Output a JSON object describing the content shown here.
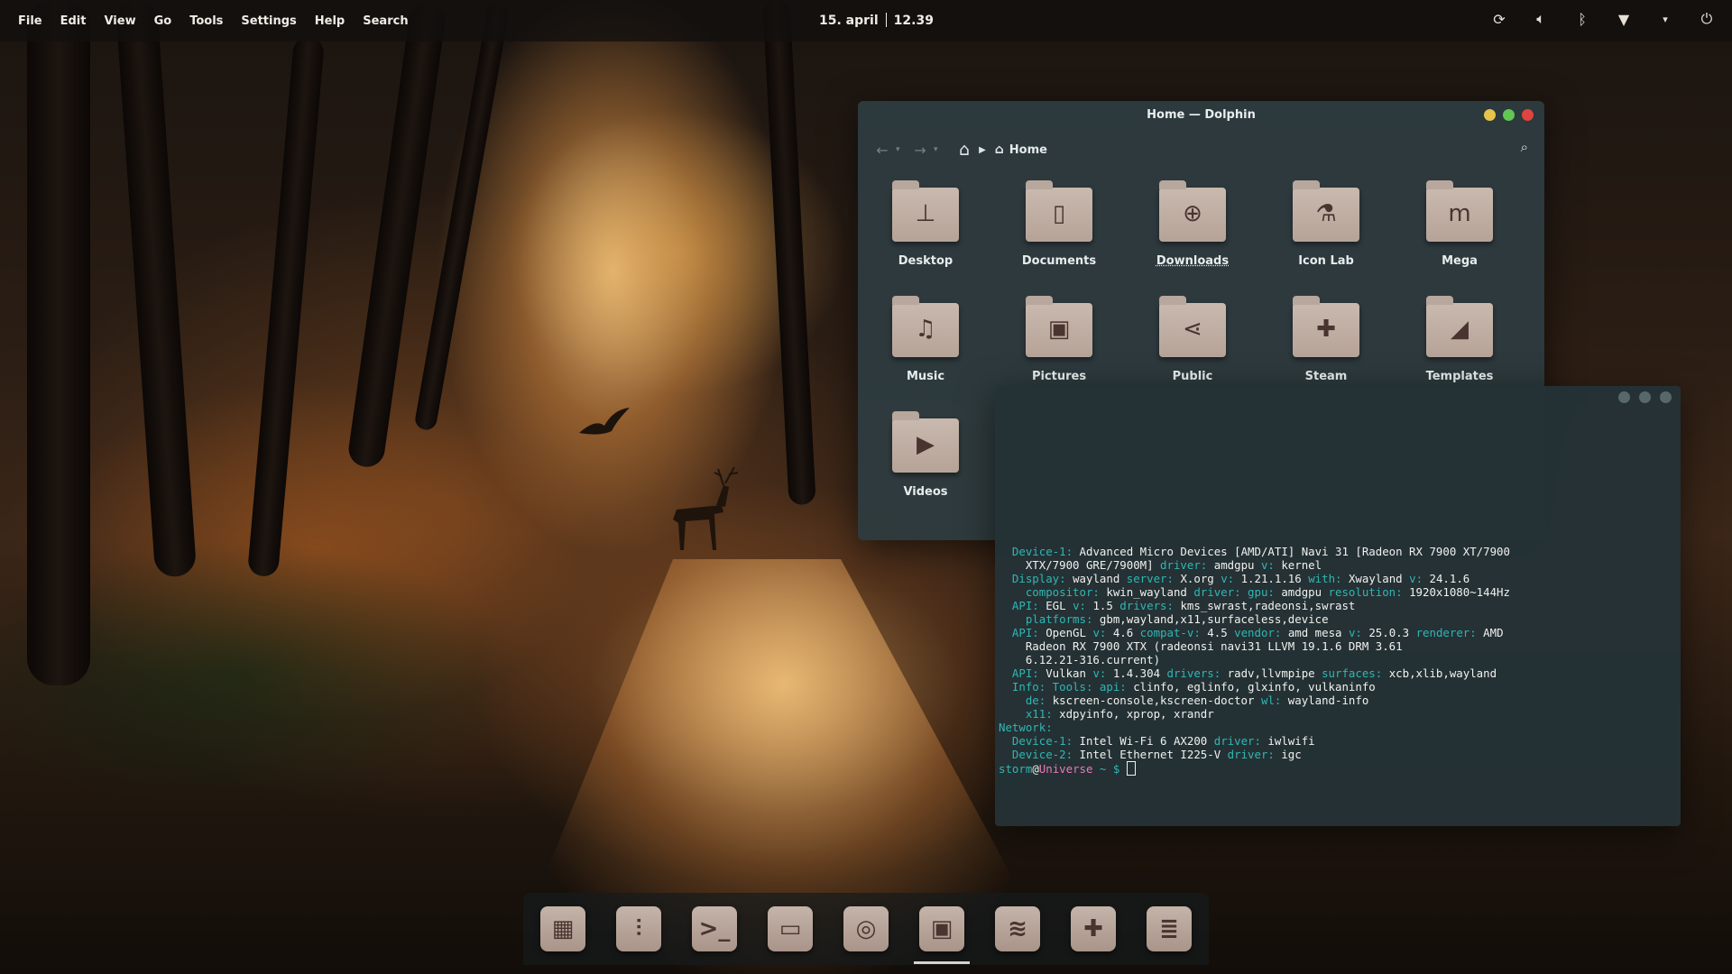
{
  "menu_bar": [
    "File",
    "Edit",
    "View",
    "Go",
    "Tools",
    "Settings",
    "Help",
    "Search"
  ],
  "clock": {
    "date": "15. april",
    "time": "12.39"
  },
  "tray_icons": [
    "sync-icon",
    "volume-icon",
    "bluetooth-icon",
    "wifi-icon",
    "chevron-down-icon",
    "power-icon"
  ],
  "dolphin": {
    "title": "Home — Dolphin",
    "breadcrumb": "Home",
    "window_controls": {
      "minimize": "#e6c34a",
      "maximize": "#62c554",
      "close": "#e0443e"
    },
    "items": [
      {
        "label": "Desktop",
        "icon": "desktop-folder-icon",
        "glyph": "⊥"
      },
      {
        "label": "Documents",
        "icon": "documents-folder-icon",
        "glyph": "▯"
      },
      {
        "label": "Downloads",
        "icon": "downloads-folder-icon",
        "glyph": "⊕"
      },
      {
        "label": "Icon Lab",
        "icon": "flask-folder-icon",
        "glyph": "⚗"
      },
      {
        "label": "Mega",
        "icon": "mega-folder-icon",
        "glyph": "m"
      },
      {
        "label": "Music",
        "icon": "music-folder-icon",
        "glyph": "♫"
      },
      {
        "label": "Pictures",
        "icon": "pictures-folder-icon",
        "glyph": "▣"
      },
      {
        "label": "Public",
        "icon": "share-folder-icon",
        "glyph": "⋖"
      },
      {
        "label": "Steam",
        "icon": "gamepad-folder-icon",
        "glyph": "✚"
      },
      {
        "label": "Templates",
        "icon": "templates-folder-icon",
        "glyph": "◢"
      },
      {
        "label": "Videos",
        "icon": "videos-folder-icon",
        "glyph": "▶"
      }
    ]
  },
  "terminal": {
    "lines": [
      [
        {
          "c": "k",
          "t": "  Device-1: "
        },
        {
          "c": "v",
          "t": "Advanced Micro Devices [AMD/ATI] Navi 31 [Radeon RX 7900 XT/7900"
        }
      ],
      [
        {
          "c": "v",
          "t": "    XTX/7900 GRE/7900M] "
        },
        {
          "c": "k",
          "t": "driver: "
        },
        {
          "c": "v",
          "t": "amdgpu "
        },
        {
          "c": "k",
          "t": "v: "
        },
        {
          "c": "v",
          "t": "kernel"
        }
      ],
      [
        {
          "c": "k",
          "t": "  Display: "
        },
        {
          "c": "v",
          "t": "wayland "
        },
        {
          "c": "k",
          "t": "server: "
        },
        {
          "c": "v",
          "t": "X.org "
        },
        {
          "c": "k",
          "t": "v: "
        },
        {
          "c": "v",
          "t": "1.21.1.16 "
        },
        {
          "c": "k",
          "t": "with: "
        },
        {
          "c": "v",
          "t": "Xwayland "
        },
        {
          "c": "k",
          "t": "v: "
        },
        {
          "c": "v",
          "t": "24.1.6"
        }
      ],
      [
        {
          "c": "k",
          "t": "    compositor: "
        },
        {
          "c": "v",
          "t": "kwin_wayland "
        },
        {
          "c": "k",
          "t": "driver: gpu: "
        },
        {
          "c": "v",
          "t": "amdgpu "
        },
        {
          "c": "k",
          "t": "resolution: "
        },
        {
          "c": "v",
          "t": "1920x1080~144Hz"
        }
      ],
      [
        {
          "c": "k",
          "t": "  API: "
        },
        {
          "c": "v",
          "t": "EGL "
        },
        {
          "c": "k",
          "t": "v: "
        },
        {
          "c": "v",
          "t": "1.5 "
        },
        {
          "c": "k",
          "t": "drivers: "
        },
        {
          "c": "v",
          "t": "kms_swrast,radeonsi,swrast"
        }
      ],
      [
        {
          "c": "k",
          "t": "    platforms: "
        },
        {
          "c": "v",
          "t": "gbm,wayland,x11,surfaceless,device"
        }
      ],
      [
        {
          "c": "k",
          "t": "  API: "
        },
        {
          "c": "v",
          "t": "OpenGL "
        },
        {
          "c": "k",
          "t": "v: "
        },
        {
          "c": "v",
          "t": "4.6 "
        },
        {
          "c": "k",
          "t": "compat-v: "
        },
        {
          "c": "v",
          "t": "4.5 "
        },
        {
          "c": "k",
          "t": "vendor: "
        },
        {
          "c": "v",
          "t": "amd mesa "
        },
        {
          "c": "k",
          "t": "v: "
        },
        {
          "c": "v",
          "t": "25.0.3 "
        },
        {
          "c": "k",
          "t": "renderer: "
        },
        {
          "c": "v",
          "t": "AMD"
        }
      ],
      [
        {
          "c": "v",
          "t": "    Radeon RX 7900 XTX (radeonsi navi31 LLVM 19.1.6 DRM 3.61"
        }
      ],
      [
        {
          "c": "v",
          "t": "    6.12.21-316.current)"
        }
      ],
      [
        {
          "c": "k",
          "t": "  API: "
        },
        {
          "c": "v",
          "t": "Vulkan "
        },
        {
          "c": "k",
          "t": "v: "
        },
        {
          "c": "v",
          "t": "1.4.304 "
        },
        {
          "c": "k",
          "t": "drivers: "
        },
        {
          "c": "v",
          "t": "radv,llvmpipe "
        },
        {
          "c": "k",
          "t": "surfaces: "
        },
        {
          "c": "v",
          "t": "xcb,xlib,wayland"
        }
      ],
      [
        {
          "c": "k",
          "t": "  Info: Tools: api: "
        },
        {
          "c": "v",
          "t": "clinfo, eglinfo, glxinfo, vulkaninfo"
        }
      ],
      [
        {
          "c": "k",
          "t": "    de: "
        },
        {
          "c": "v",
          "t": "kscreen-console,kscreen-doctor "
        },
        {
          "c": "k",
          "t": "wl: "
        },
        {
          "c": "v",
          "t": "wayland-info"
        }
      ],
      [
        {
          "c": "k",
          "t": "    x11: "
        },
        {
          "c": "v",
          "t": "xdpyinfo, xprop, xrandr"
        }
      ],
      [
        {
          "c": "sec",
          "t": "Network:"
        }
      ],
      [
        {
          "c": "k",
          "t": "  Device-1: "
        },
        {
          "c": "v",
          "t": "Intel Wi-Fi 6 AX200 "
        },
        {
          "c": "k",
          "t": "driver: "
        },
        {
          "c": "v",
          "t": "iwlwifi"
        }
      ],
      [
        {
          "c": "k",
          "t": "  Device-2: "
        },
        {
          "c": "v",
          "t": "Intel Ethernet I225-V "
        },
        {
          "c": "k",
          "t": "driver: "
        },
        {
          "c": "v",
          "t": "igc"
        }
      ]
    ],
    "prompt": {
      "user": "storm",
      "at": "@",
      "host": "Universe",
      "rest": " ~ $ "
    }
  },
  "dock": [
    {
      "name": "app-grid-icon",
      "glyph": "▦"
    },
    {
      "name": "mixer-icon",
      "glyph": "⫶"
    },
    {
      "name": "terminal-icon",
      "glyph": ">_"
    },
    {
      "name": "briefcase-icon",
      "glyph": "▭"
    },
    {
      "name": "browser-icon",
      "glyph": "◎"
    },
    {
      "name": "files-icon",
      "glyph": "▣",
      "active": true
    },
    {
      "name": "rss-icon",
      "glyph": "≋"
    },
    {
      "name": "gamepad-icon",
      "glyph": "✚"
    },
    {
      "name": "layers-icon",
      "glyph": "≣"
    }
  ]
}
